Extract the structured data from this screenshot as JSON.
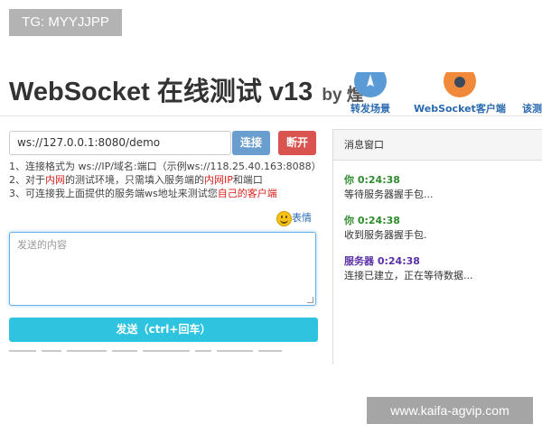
{
  "watermark_top": "TG: MYYJJPP",
  "watermark_bottom": "www.kaifa-agvip.com",
  "header": {
    "title": "WebSocket 在线测试 v13",
    "byline": "by 煌",
    "nav": [
      {
        "label": "转发场景",
        "icon": "rocket-icon",
        "color": "#5b9bd5"
      },
      {
        "label": "WebSocket客户端",
        "icon": "client-icon",
        "color": "#f0893a"
      },
      {
        "label": "该测",
        "icon": "",
        "color": ""
      }
    ]
  },
  "connection": {
    "url": "ws://127.0.0.1:8080/demo",
    "connect_label": "连接",
    "disconnect_label": "断开"
  },
  "tips": {
    "line1": "1、连接格式为 ws://IP/域名:端口（示例ws://118.25.40.163:8088）",
    "line2_a": "2、对于",
    "line2_red1": "内网",
    "line2_b": "的测试环境，只需填入服务端的",
    "line2_red2": "内网IP",
    "line2_c": "和端口",
    "line3_a": "3、可连接我上面提供的服务端ws地址来测试您",
    "line3_red": "自己的客户端"
  },
  "emoji_label": "表情",
  "message_input": {
    "placeholder": "发送的内容",
    "value": ""
  },
  "send_label": "发送（ctrl+回车）",
  "panel": {
    "title": "消息窗口",
    "messages": [
      {
        "sender": "你 0:24:38",
        "text": "等待服务器握手包...",
        "color": "#2e8b2e"
      },
      {
        "sender": "你 0:24:38",
        "text": "收到服务器握手包.",
        "color": "#2e8b2e"
      },
      {
        "sender": "服务器 0:24:38",
        "text": "连接已建立，正在等待数据...",
        "color": "#5a2fa6"
      }
    ]
  },
  "colors": {
    "connect": "#6a9ecf",
    "disconnect": "#d9534f",
    "send": "#2ec3de",
    "link": "#2a6ab0",
    "highlight": "#d9201c"
  }
}
